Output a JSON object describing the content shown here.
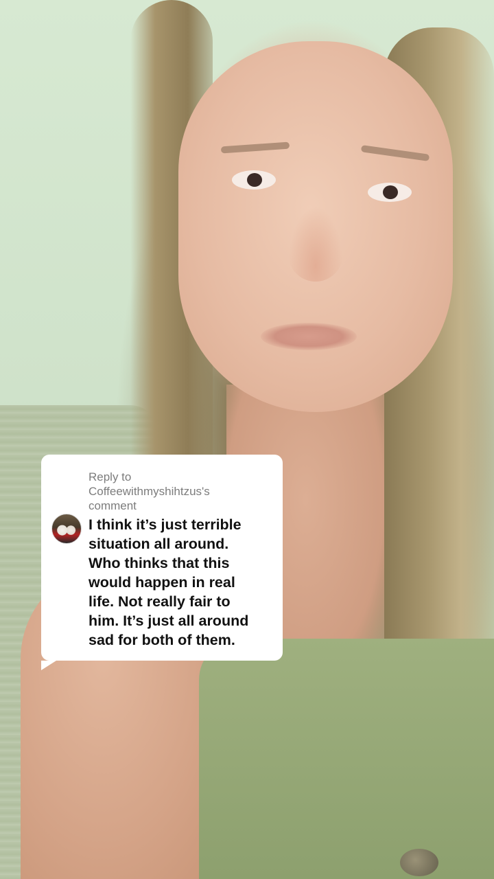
{
  "reply": {
    "label": "Reply to",
    "username": "Coffeewithmyshihtzus's",
    "suffix": "comment",
    "avatar_icon": "user-avatar-icon",
    "comment_lines": [
      "I think it’s just terrible",
      "situation all around.",
      "Who thinks that this",
      "would happen in real",
      "life. Not really fair to",
      "him. It’s just all around",
      "sad for both of them."
    ]
  },
  "colors": {
    "card_background": "#ffffff",
    "header_text": "#7c7c7c",
    "comment_text": "#111111"
  }
}
